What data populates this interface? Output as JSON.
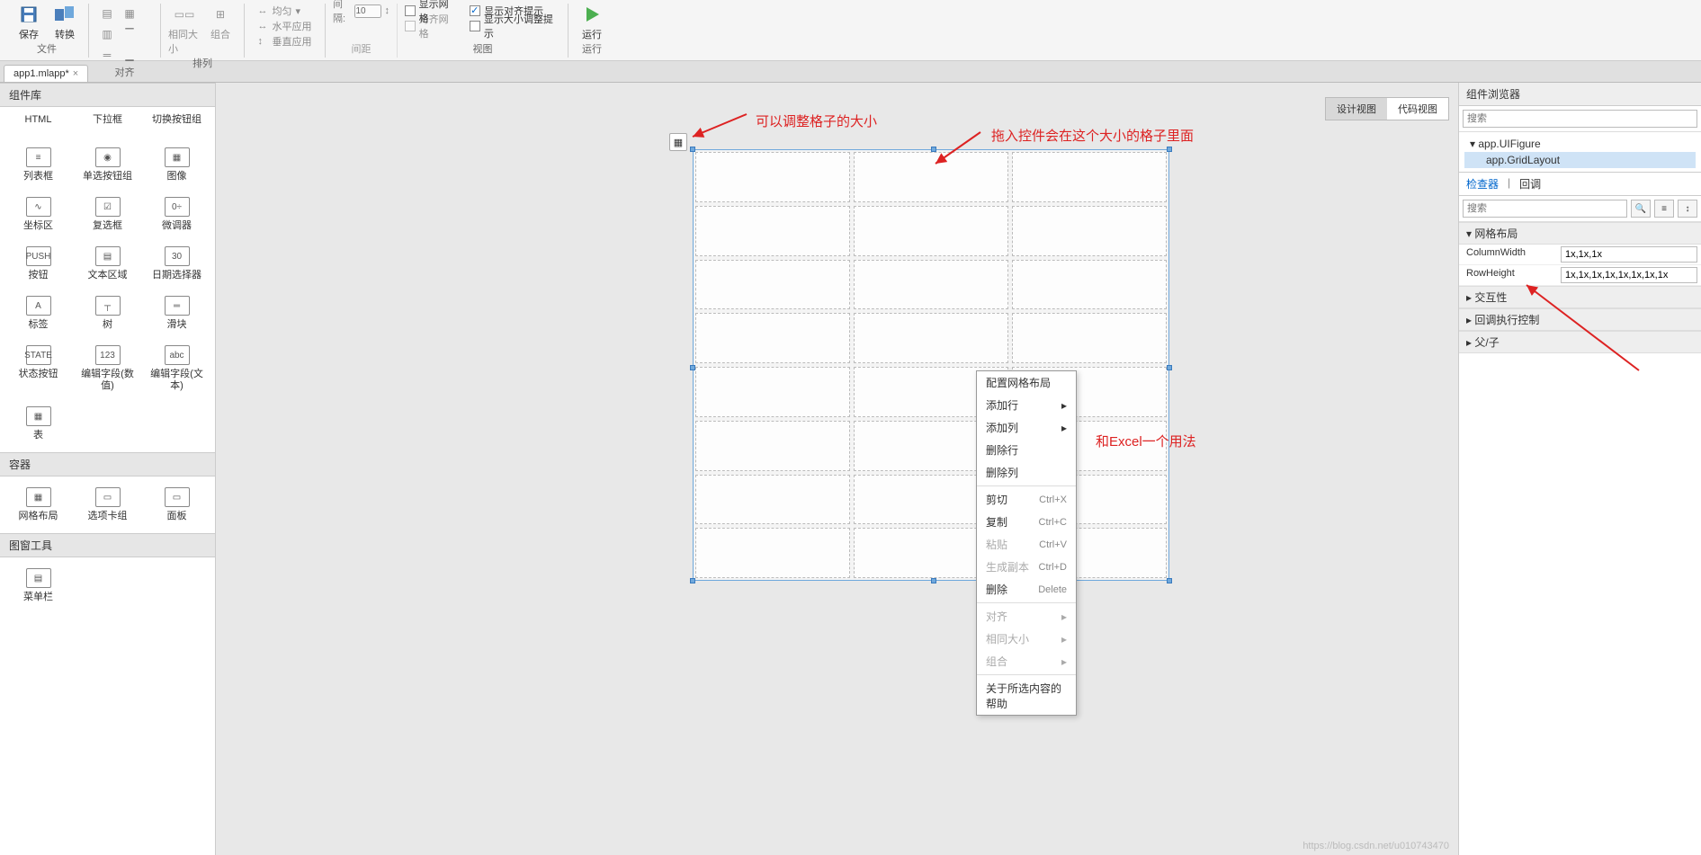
{
  "ribbon": {
    "file": {
      "save": "保存",
      "convert": "转换",
      "label": "文件"
    },
    "align": {
      "same": "相同大小",
      "group": "组合",
      "label": "对齐"
    },
    "arrange": {
      "avg": "均匀",
      "hv": "水平应用",
      "vert": "垂直应用",
      "label": "排列"
    },
    "spacing": {
      "label": "间距",
      "num": "10",
      "numlabel": "间隔:"
    },
    "view": {
      "c1": "显示网格",
      "c2": "对齐网格",
      "c3": "显示对齐提示",
      "c4": "显示大小调整提示",
      "label": "视图"
    },
    "run": {
      "btn": "运行",
      "label": "运行"
    }
  },
  "tab": {
    "name": "app1.mlapp*"
  },
  "sidebar": {
    "libTitle": "组件库",
    "row0": [
      "HTML",
      "下拉框",
      "切换按钮组"
    ],
    "secA": [
      {
        "n": "列表框",
        "i": "≡"
      },
      {
        "n": "单选按钮组",
        "i": "◉"
      },
      {
        "n": "图像",
        "i": "▦"
      },
      {
        "n": "坐标区",
        "i": "∿"
      },
      {
        "n": "复选框",
        "i": "☑"
      },
      {
        "n": "微调器",
        "i": "0÷"
      },
      {
        "n": "按钮",
        "i": "PUSH"
      },
      {
        "n": "文本区域",
        "i": "▤"
      },
      {
        "n": "日期选择器",
        "i": "30"
      },
      {
        "n": "标签",
        "i": "A"
      },
      {
        "n": "树",
        "i": "┬"
      },
      {
        "n": "滑块",
        "i": "═"
      },
      {
        "n": "状态按钮",
        "i": "STATE"
      },
      {
        "n": "编辑字段(数值)",
        "i": "123"
      },
      {
        "n": "编辑字段(文本)",
        "i": "abc"
      },
      {
        "n": "表",
        "i": "▦"
      },
      {
        "n": "",
        "i": ""
      },
      {
        "n": "",
        "i": ""
      }
    ],
    "containerTitle": "容器",
    "containers": [
      {
        "n": "网格布局",
        "i": "▦"
      },
      {
        "n": "选项卡组",
        "i": "▭"
      },
      {
        "n": "面板",
        "i": "▭"
      }
    ],
    "figTitle": "图窗工具",
    "fig": [
      {
        "n": "菜单栏",
        "i": "▤"
      }
    ]
  },
  "canvas": {
    "designView": "设计视图",
    "codeView": "代码视图"
  },
  "ctx": {
    "config": "配置网格布局",
    "addRow": "添加行",
    "addCol": "添加列",
    "delRow": "删除行",
    "delCol": "删除列",
    "cut": "剪切",
    "copy": "复制",
    "paste": "粘贴",
    "dup": "生成副本",
    "del": "删除",
    "align": "对齐",
    "same": "相同大小",
    "grp": "组合",
    "help": "关于所选内容的帮助",
    "scCut": "Ctrl+X",
    "scCopy": "Ctrl+C",
    "scPaste": "Ctrl+V",
    "scDup": "Ctrl+D",
    "scDel": "Delete"
  },
  "ann": {
    "a1": "可以调整格子的大小",
    "a2": "拖入控件会在这个大小的格子里面",
    "a3": "和Excel一个用法"
  },
  "rpanel": {
    "title": "组件浏览器",
    "search": "搜索",
    "tree": {
      "root": "app.UIFigure",
      "child": "app.GridLayout"
    },
    "tabs": {
      "inspector": "检查器",
      "cb": "回调"
    },
    "sec1": "网格布局",
    "colW": {
      "label": "ColumnWidth",
      "val": "1x,1x,1x"
    },
    "rowH": {
      "label": "RowHeight",
      "val": "1x,1x,1x,1x,1x,1x,1x,1x"
    },
    "sec2": "交互性",
    "sec3": "回调执行控制",
    "sec4": "父/子"
  },
  "watermark": "https://blog.csdn.net/u010743470"
}
